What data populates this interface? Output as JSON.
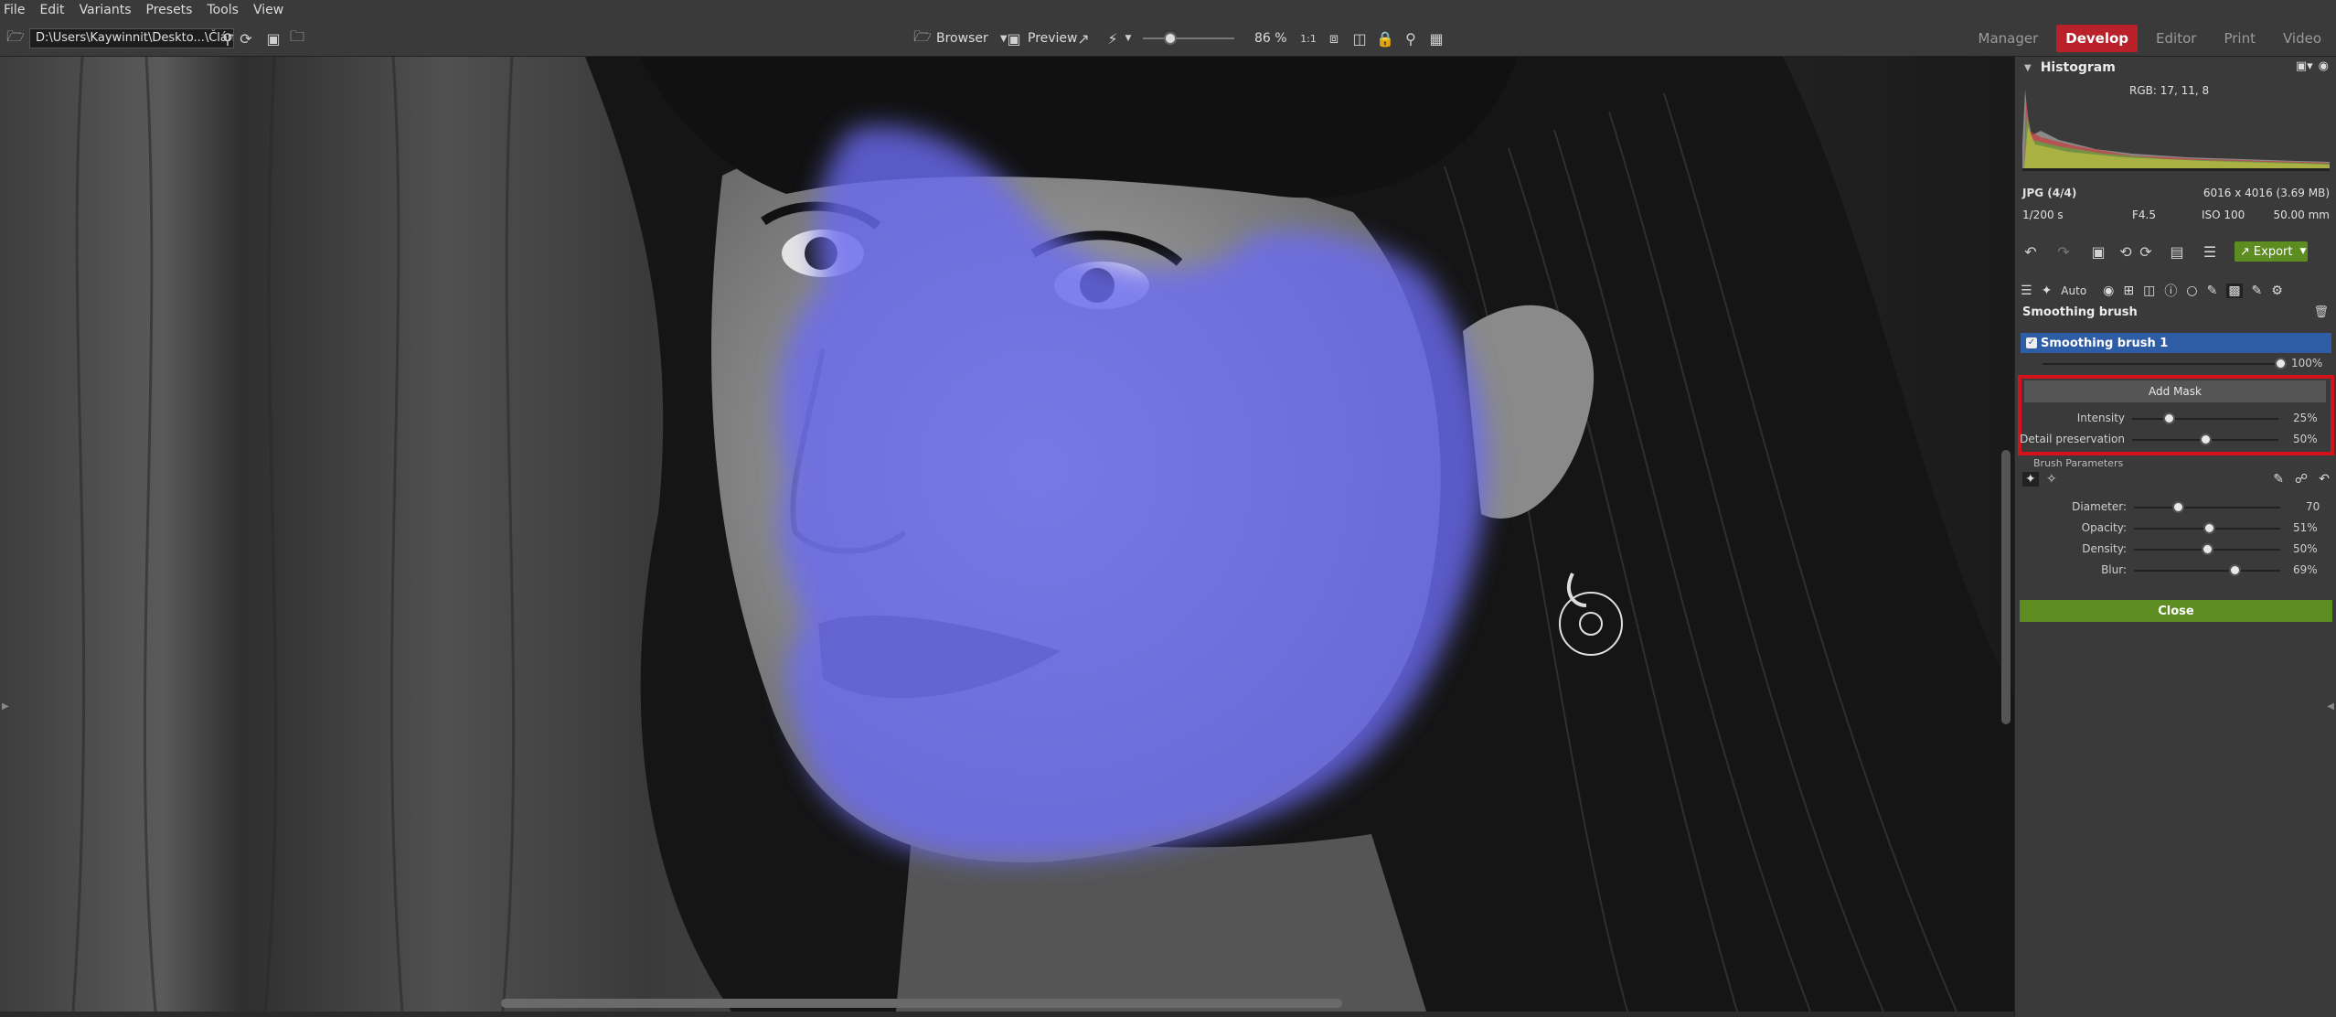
{
  "menu": [
    "File",
    "Edit",
    "Variants",
    "Presets",
    "Tools",
    "View"
  ],
  "toolbar": {
    "path": "D:\\Users\\Kaywinnit\\Deskto...\\Článek",
    "browser_label": "Browser",
    "preview_label": "Preview",
    "zoom_value": "86 %",
    "zoom_fraction": 0.3
  },
  "modules": [
    "Manager",
    "Develop",
    "Editor",
    "Print",
    "Video"
  ],
  "active_module": "Develop",
  "histogram": {
    "title": "Histogram",
    "rgb_readout": "RGB:  17,  11,   8",
    "format": "JPG  (4/4)",
    "dimensions": "6016 x 4016 (3.69 MB)",
    "shutter": "1/200 s",
    "aperture": "F4.5",
    "iso": "ISO 100",
    "focal": "50.00 mm"
  },
  "actions": {
    "export_label": "Export",
    "auto_label": "Auto"
  },
  "tool_panel": {
    "title": "Smoothing brush",
    "brush_item": "Smoothing brush 1",
    "brush_amount": "100%",
    "brush_amount_fraction": 1.0,
    "add_mask_label": "Add Mask",
    "intensity_label": "Intensity",
    "intensity_value": "25%",
    "intensity_fraction": 0.25,
    "detail_label": "Detail preservation",
    "detail_value": "50%",
    "detail_fraction": 0.5,
    "brush_params_title": "Brush Parameters",
    "diameter_label": "Diameter:",
    "diameter_value": "70",
    "diameter_fraction": 0.3,
    "opacity_label": "Opacity:",
    "opacity_value": "51%",
    "opacity_fraction": 0.51,
    "density_label": "Density:",
    "density_value": "50%",
    "density_fraction": 0.5,
    "blur_label": "Blur:",
    "blur_value": "69%",
    "blur_fraction": 0.69,
    "close_label": "Close"
  },
  "colors": {
    "accent_red": "#b9202a",
    "green_button": "#5d8c21",
    "selection_blue": "#2f5da5",
    "mask_overlay": "#6a6af0",
    "highlight_box": "#d4121a"
  }
}
